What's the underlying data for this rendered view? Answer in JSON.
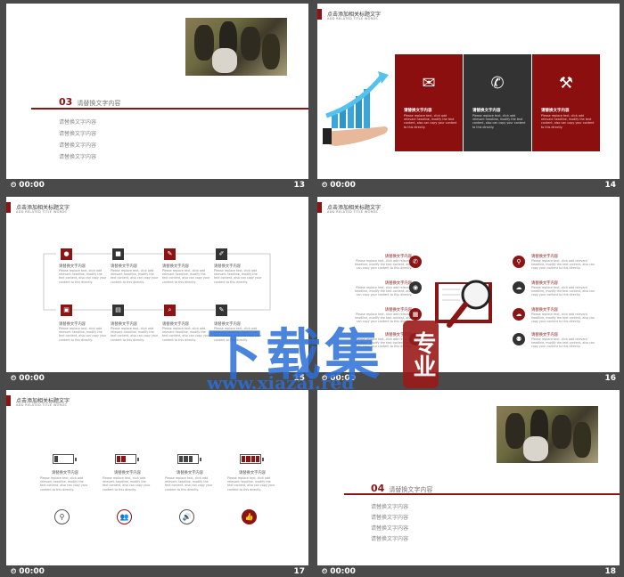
{
  "slides": [
    {
      "num": "13",
      "time": "00:00",
      "section_num": "03",
      "section_title": "请替换文字内容",
      "lines": [
        "请替换文字内容",
        "请替换文字内容",
        "请替换文字内容",
        "请替换文字内容"
      ]
    },
    {
      "num": "14",
      "time": "00:00",
      "header_title": "点击添加相关标题文字",
      "header_sub": "ADD RELATED TITLE WORDS",
      "cards": [
        {
          "title": "请替换文字内容",
          "text": "Please replace text, click add relevant headline, modify the text content, also can copy your content to this directly.",
          "bg": "#8b0f0f",
          "icon": "envelope-icon",
          "glyph": "✉"
        },
        {
          "title": "请替换文字内容",
          "text": "Please replace text, click add relevant headline, modify the text content, also can copy your content to this directly.",
          "bg": "#333333",
          "icon": "phone-icon",
          "glyph": "✆"
        },
        {
          "title": "请替换文字内容",
          "text": "Please replace text, click add relevant headline, modify the text content, also can copy your content to this directly.",
          "bg": "#8b0f0f",
          "icon": "tools-icon",
          "glyph": "⚒"
        }
      ]
    },
    {
      "num": "15",
      "time": "00:00",
      "header_title": "点击添加相关标题文字",
      "header_sub": "ADD RELATED TITLE WORDS",
      "steps": [
        {
          "title": "请替换文字内容",
          "text": "Please replace text, click add relevant headline, modify the text content, also can copy your content to this directly.",
          "color": "#8b1414",
          "glyph": "👤"
        },
        {
          "title": "请替换文字内容",
          "text": "Please replace text, click add relevant headline, modify the text content, also can copy your content to this directly.",
          "color": "#333333",
          "glyph": "🔒"
        },
        {
          "title": "请替换文字内容",
          "text": "Please replace text, click add relevant headline, modify the text content, also can copy your content to this directly.",
          "color": "#8b1414",
          "glyph": "✎"
        },
        {
          "title": "请替换文字内容",
          "text": "Please replace text, click add relevant headline, modify the text content, also can copy your content to this directly.",
          "color": "#333333",
          "glyph": "✐"
        },
        {
          "title": "请替换文字内容",
          "text": "Please replace text, click add relevant headline, modify the text content, also can copy your content to this directly.",
          "color": "#8b1414",
          "glyph": "▣"
        },
        {
          "title": "请替换文字内容",
          "text": "Please replace text, click add relevant headline, modify the text content, also can copy your content to this directly.",
          "color": "#333333",
          "glyph": "▤"
        },
        {
          "title": "请替换文字内容",
          "text": "Please replace text, click add relevant headline, modify the text content, also can copy your content to this directly.",
          "color": "#8b1414",
          "glyph": "⌕"
        },
        {
          "title": "请替换文字内容",
          "text": "Please replace text, click add relevant headline, modify the text content, also can copy your content to this directly.",
          "color": "#333333",
          "glyph": "✎"
        }
      ]
    },
    {
      "num": "16",
      "time": "00:00",
      "header_title": "点击添加相关标题文字",
      "header_sub": "ADD RELATED TITLE WORDS",
      "items_left": [
        {
          "title": "请替换文字内容",
          "text": "Please replace text, click add relevant headline, modify the text content, also can copy your content to this directly.",
          "color": "#8b1414",
          "glyph": "✆"
        },
        {
          "title": "请替换文字内容",
          "text": "Please replace text, click add relevant headline, modify the text content, also can copy your content to this directly.",
          "color": "#333333",
          "glyph": "◉"
        },
        {
          "title": "请替换文字内容",
          "text": "Please replace text, click add relevant headline, modify the text content, also can copy your content to this directly.",
          "color": "#8b1414",
          "glyph": "▦"
        },
        {
          "title": "请替换文字内容",
          "text": "Please replace text, click add relevant headline, modify the text content, also can copy your content to this directly.",
          "color": "#333333",
          "glyph": "✉"
        }
      ],
      "items_right": [
        {
          "title": "请替换文字内容",
          "text": "Please replace text, click add relevant headline, modify the text content, also can copy your content to this directly.",
          "color": "#8b1414",
          "glyph": "⚲"
        },
        {
          "title": "请替换文字内容",
          "text": "Please replace text, click add relevant headline, modify the text content, also can copy your content to this directly.",
          "color": "#333333",
          "glyph": "☁"
        },
        {
          "title": "请替换文字内容",
          "text": "Please replace text, click add relevant headline, modify the text content, also can copy your content to this directly.",
          "color": "#8b1414",
          "glyph": "☁"
        },
        {
          "title": "请替换文字内容",
          "text": "Please replace text, click add relevant headline, modify the text content, also can copy your content to this directly.",
          "color": "#333333",
          "glyph": "⚉"
        }
      ]
    },
    {
      "num": "17",
      "time": "00:00",
      "header_title": "点击添加相关标题文字",
      "header_sub": "ADD RELATED TITLE WORDS",
      "batteries": [
        {
          "title": "请替换文字内容",
          "text": "Please replace text, click add relevant headline, modify the text content, also can copy your content to this directly.",
          "level": 0.25,
          "fill": "#444444",
          "glyph": "⚲",
          "icon": "search-icon"
        },
        {
          "title": "请替换文字内容",
          "text": "Please replace text, click add relevant headline, modify the text content, also can copy your content to this directly.",
          "level": 0.5,
          "fill": "#8b1414",
          "glyph": "👥",
          "icon": "users-icon"
        },
        {
          "title": "请替换文字内容",
          "text": "Please replace text, click add relevant headline, modify the text content, also can copy your content to this directly.",
          "level": 0.75,
          "fill": "#444444",
          "glyph": "🔊",
          "icon": "speaker-icon"
        },
        {
          "title": "请替换文字内容",
          "text": "Please replace text, click add relevant headline, modify the text content, also can copy your content to this directly.",
          "level": 1.0,
          "fill": "#8b1414",
          "glyph": "👍",
          "icon": "thumbs-up-icon"
        }
      ]
    },
    {
      "num": "18",
      "time": "00:00",
      "section_num": "04",
      "section_title": "请替换文字内容",
      "lines": [
        "请替换文字内容",
        "请替换文字内容",
        "请替换文字内容",
        "请替换文字内容"
      ]
    }
  ],
  "watermark": {
    "text": "下载集",
    "url": "www.xiazai.red",
    "seal": "专业"
  },
  "colors": {
    "accent": "#8b1414",
    "dark": "#333333",
    "bar": "#4a4a4a"
  }
}
